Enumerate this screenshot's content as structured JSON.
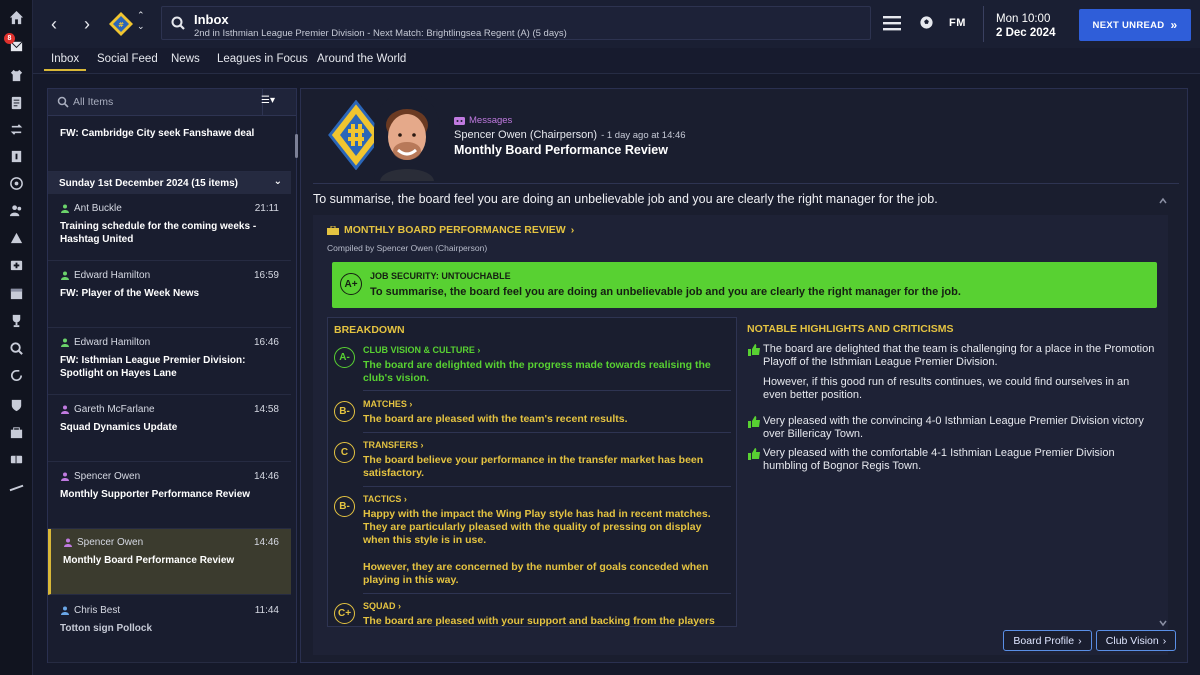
{
  "rail": {
    "notification_count": "8"
  },
  "header": {
    "inbox_title": "Inbox",
    "inbox_subtitle": "2nd in Isthmian League Premier Division - Next Match: Brightlingsea Regent (A) (5 days)",
    "brand": "FM",
    "time": "Mon 10:00",
    "date": "2 Dec 2024",
    "next_unread": "NEXT UNREAD"
  },
  "tabs": [
    "Inbox",
    "Social Feed",
    "News",
    "Leagues in Focus",
    "Around the World"
  ],
  "list": {
    "filter_placeholder": "All Items",
    "top_item": {
      "subject": "FW: Cambridge City seek Fanshawe deal"
    },
    "day_header": "Sunday 1st December 2024 (15 items)",
    "items": [
      {
        "sender": "Ant Buckle",
        "time": "21:11",
        "subject": "Training schedule for the coming weeks - Hashtag United"
      },
      {
        "sender": "Edward Hamilton",
        "time": "16:59",
        "subject": "FW: Player of the Week News"
      },
      {
        "sender": "Edward Hamilton",
        "time": "16:46",
        "subject": "FW: Isthmian League Premier Division: Spotlight on Hayes Lane"
      },
      {
        "sender": "Gareth McFarlane",
        "time": "14:58",
        "subject": "Squad Dynamics Update"
      },
      {
        "sender": "Spencer Owen",
        "time": "14:46",
        "subject": "Monthly Supporter Performance Review"
      },
      {
        "sender": "Spencer Owen",
        "time": "14:46",
        "subject": "Monthly Board Performance Review"
      },
      {
        "sender": "Chris Best",
        "time": "11:44",
        "subject": "Totton sign Pollock"
      }
    ]
  },
  "message": {
    "tag": "Messages",
    "from": "Spencer Owen (Chairperson)",
    "ago": "- 1 day ago at 14:46",
    "title": "Monthly Board Performance Review",
    "summary": "To summarise, the board feel you are doing an unbelievable job and you are clearly the right manager for the job.",
    "report_title": "MONTHLY BOARD PERFORMANCE REVIEW",
    "compiled": "Compiled by Spencer Owen (Chairperson)",
    "job_security": {
      "grade": "A+",
      "label": "JOB SECURITY: UNTOUCHABLE",
      "text": "To summarise, the board feel you are doing an unbelievable job and you are clearly the right manager for the job."
    },
    "breakdown_title": "BREAKDOWN",
    "breakdown": [
      {
        "grade": "A-",
        "category": "CLUB VISION & CULTURE",
        "text": "The board are delighted with the progress made towards realising the club's vision."
      },
      {
        "grade": "B-",
        "category": "MATCHES",
        "text": "The board are pleased with the team's recent results."
      },
      {
        "grade": "C",
        "category": "TRANSFERS",
        "text": "The board believe your performance in the transfer market has been satisfactory."
      },
      {
        "grade": "B-",
        "category": "TACTICS",
        "text": "Happy with the impact the Wing Play style has had in recent matches. They are particularly pleased with the quality of pressing on display when this style is in use.",
        "text2": "However, they are concerned by the number of goals conceded when playing in this way."
      },
      {
        "grade": "C+",
        "category": "SQUAD",
        "text": "The board are pleased with your support and backing from the players"
      }
    ],
    "highlights_title": "NOTABLE HIGHLIGHTS AND CRITICISMS",
    "highlights": [
      {
        "text": "The board are delighted that the team is challenging for a place in the Promotion Playoff of the Isthmian League Premier Division.",
        "text2": "However, if this good run of results continues, we could find ourselves in an even better position."
      },
      {
        "text": "Very pleased with the convincing 4-0 Isthmian League Premier Division victory over Billericay Town."
      },
      {
        "text": "Very pleased with the comfortable 4-1 Isthmian League Premier Division humbling of Bognor Regis Town."
      }
    ],
    "buttons": {
      "board_profile": "Board Profile",
      "club_vision": "Club Vision"
    }
  },
  "colors": {
    "accent_blue": "#2f5ed9",
    "gold": "#d9b838",
    "grade_green": "#58d132",
    "grade_yellow": "#e4c341",
    "tag_purple": "#c07ae0"
  }
}
